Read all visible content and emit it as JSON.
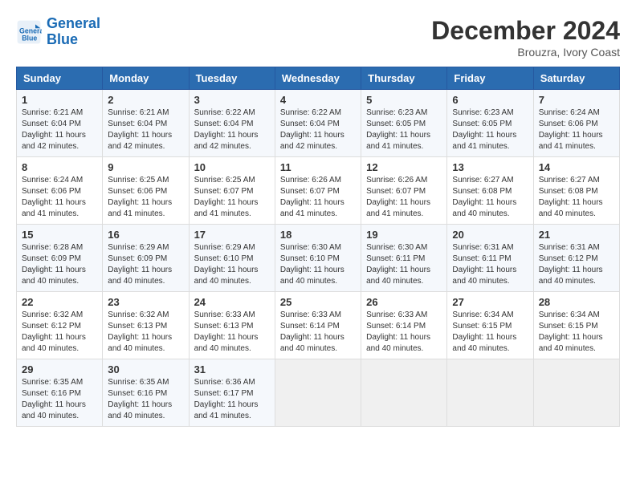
{
  "logo": {
    "line1": "General",
    "line2": "Blue"
  },
  "title": "December 2024",
  "subtitle": "Brouzra, Ivory Coast",
  "headers": [
    "Sunday",
    "Monday",
    "Tuesday",
    "Wednesday",
    "Thursday",
    "Friday",
    "Saturday"
  ],
  "weeks": [
    [
      {
        "day": "1",
        "sunrise": "6:21 AM",
        "sunset": "6:04 PM",
        "daylight": "11 hours and 42 minutes."
      },
      {
        "day": "2",
        "sunrise": "6:21 AM",
        "sunset": "6:04 PM",
        "daylight": "11 hours and 42 minutes."
      },
      {
        "day": "3",
        "sunrise": "6:22 AM",
        "sunset": "6:04 PM",
        "daylight": "11 hours and 42 minutes."
      },
      {
        "day": "4",
        "sunrise": "6:22 AM",
        "sunset": "6:04 PM",
        "daylight": "11 hours and 42 minutes."
      },
      {
        "day": "5",
        "sunrise": "6:23 AM",
        "sunset": "6:05 PM",
        "daylight": "11 hours and 41 minutes."
      },
      {
        "day": "6",
        "sunrise": "6:23 AM",
        "sunset": "6:05 PM",
        "daylight": "11 hours and 41 minutes."
      },
      {
        "day": "7",
        "sunrise": "6:24 AM",
        "sunset": "6:06 PM",
        "daylight": "11 hours and 41 minutes."
      }
    ],
    [
      {
        "day": "8",
        "sunrise": "6:24 AM",
        "sunset": "6:06 PM",
        "daylight": "11 hours and 41 minutes."
      },
      {
        "day": "9",
        "sunrise": "6:25 AM",
        "sunset": "6:06 PM",
        "daylight": "11 hours and 41 minutes."
      },
      {
        "day": "10",
        "sunrise": "6:25 AM",
        "sunset": "6:07 PM",
        "daylight": "11 hours and 41 minutes."
      },
      {
        "day": "11",
        "sunrise": "6:26 AM",
        "sunset": "6:07 PM",
        "daylight": "11 hours and 41 minutes."
      },
      {
        "day": "12",
        "sunrise": "6:26 AM",
        "sunset": "6:07 PM",
        "daylight": "11 hours and 41 minutes."
      },
      {
        "day": "13",
        "sunrise": "6:27 AM",
        "sunset": "6:08 PM",
        "daylight": "11 hours and 40 minutes."
      },
      {
        "day": "14",
        "sunrise": "6:27 AM",
        "sunset": "6:08 PM",
        "daylight": "11 hours and 40 minutes."
      }
    ],
    [
      {
        "day": "15",
        "sunrise": "6:28 AM",
        "sunset": "6:09 PM",
        "daylight": "11 hours and 40 minutes."
      },
      {
        "day": "16",
        "sunrise": "6:29 AM",
        "sunset": "6:09 PM",
        "daylight": "11 hours and 40 minutes."
      },
      {
        "day": "17",
        "sunrise": "6:29 AM",
        "sunset": "6:10 PM",
        "daylight": "11 hours and 40 minutes."
      },
      {
        "day": "18",
        "sunrise": "6:30 AM",
        "sunset": "6:10 PM",
        "daylight": "11 hours and 40 minutes."
      },
      {
        "day": "19",
        "sunrise": "6:30 AM",
        "sunset": "6:11 PM",
        "daylight": "11 hours and 40 minutes."
      },
      {
        "day": "20",
        "sunrise": "6:31 AM",
        "sunset": "6:11 PM",
        "daylight": "11 hours and 40 minutes."
      },
      {
        "day": "21",
        "sunrise": "6:31 AM",
        "sunset": "6:12 PM",
        "daylight": "11 hours and 40 minutes."
      }
    ],
    [
      {
        "day": "22",
        "sunrise": "6:32 AM",
        "sunset": "6:12 PM",
        "daylight": "11 hours and 40 minutes."
      },
      {
        "day": "23",
        "sunrise": "6:32 AM",
        "sunset": "6:13 PM",
        "daylight": "11 hours and 40 minutes."
      },
      {
        "day": "24",
        "sunrise": "6:33 AM",
        "sunset": "6:13 PM",
        "daylight": "11 hours and 40 minutes."
      },
      {
        "day": "25",
        "sunrise": "6:33 AM",
        "sunset": "6:14 PM",
        "daylight": "11 hours and 40 minutes."
      },
      {
        "day": "26",
        "sunrise": "6:33 AM",
        "sunset": "6:14 PM",
        "daylight": "11 hours and 40 minutes."
      },
      {
        "day": "27",
        "sunrise": "6:34 AM",
        "sunset": "6:15 PM",
        "daylight": "11 hours and 40 minutes."
      },
      {
        "day": "28",
        "sunrise": "6:34 AM",
        "sunset": "6:15 PM",
        "daylight": "11 hours and 40 minutes."
      }
    ],
    [
      {
        "day": "29",
        "sunrise": "6:35 AM",
        "sunset": "6:16 PM",
        "daylight": "11 hours and 40 minutes."
      },
      {
        "day": "30",
        "sunrise": "6:35 AM",
        "sunset": "6:16 PM",
        "daylight": "11 hours and 40 minutes."
      },
      {
        "day": "31",
        "sunrise": "6:36 AM",
        "sunset": "6:17 PM",
        "daylight": "11 hours and 41 minutes."
      },
      null,
      null,
      null,
      null
    ]
  ]
}
